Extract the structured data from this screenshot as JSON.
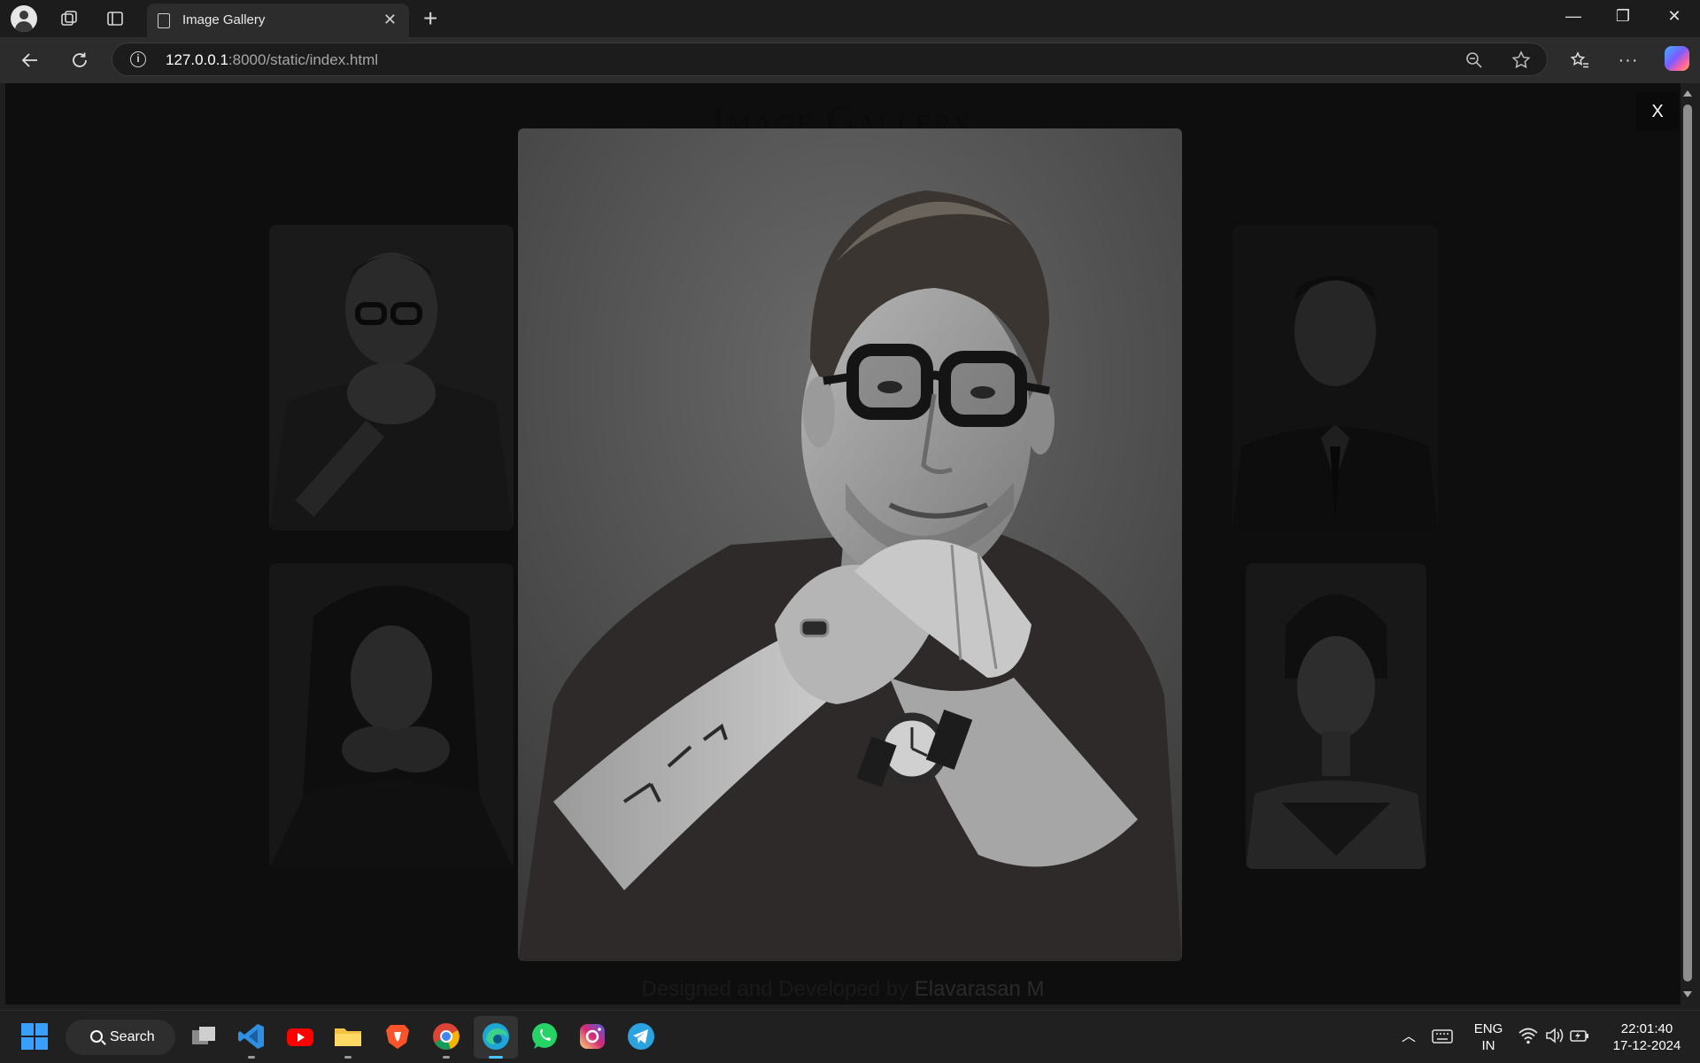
{
  "browser": {
    "tab_title": "Image Gallery",
    "url_host": "127.0.0.1",
    "url_rest": ":8000/static/index.html",
    "window_controls": {
      "minimize": "—",
      "restore": "❐",
      "close": "✕"
    }
  },
  "page": {
    "title": "Image Gallery",
    "footer_prefix": "Designed and Developed by ",
    "footer_author": "Elavarasan M",
    "close_label": "X"
  },
  "gallery": {
    "thumbnails": [
      {
        "name": "thumb-man-glasses"
      },
      {
        "name": "thumb-man-suit"
      },
      {
        "name": "thumb-woman-dark-hair"
      },
      {
        "name": "thumb-woman-portrait"
      }
    ],
    "expanded": {
      "name": "expanded-man-glasses"
    }
  },
  "taskbar": {
    "search_label": "Search",
    "lang_top": "ENG",
    "lang_bottom": "IN",
    "time": "22:01:40",
    "date": "17-12-2024"
  }
}
